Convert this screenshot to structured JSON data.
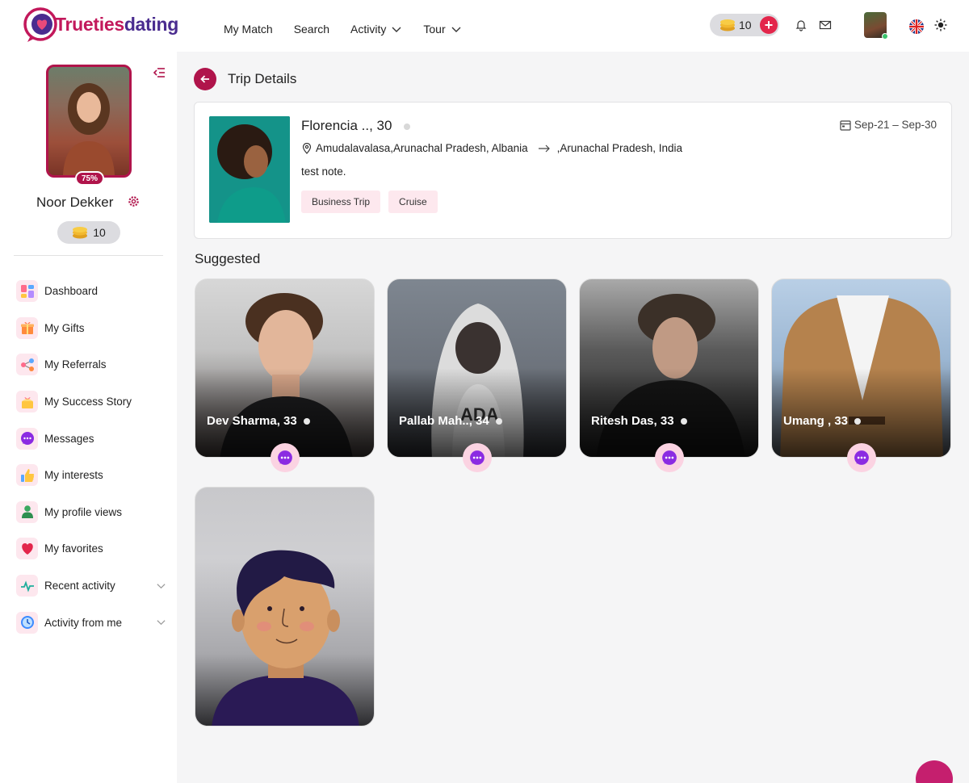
{
  "brand": {
    "part1": "Trueties",
    "part2": "dating"
  },
  "nav": [
    {
      "label": "My Match",
      "has_dropdown": false
    },
    {
      "label": "Search",
      "has_dropdown": false
    },
    {
      "label": "Activity",
      "has_dropdown": true
    },
    {
      "label": "Tour",
      "has_dropdown": true
    }
  ],
  "header": {
    "coins": "10"
  },
  "profile": {
    "name": "Noor Dekker",
    "completion": "75%",
    "coins": "10"
  },
  "menu": [
    {
      "label": "Dashboard",
      "icon": "dashboard-icon"
    },
    {
      "label": "My Gifts",
      "icon": "gift-icon"
    },
    {
      "label": "My Referrals",
      "icon": "share-icon"
    },
    {
      "label": "My Success Story",
      "icon": "box-icon"
    },
    {
      "label": "Messages",
      "icon": "chat-icon"
    },
    {
      "label": "My interests",
      "icon": "thumbs-up-icon"
    },
    {
      "label": "My profile views",
      "icon": "person-icon"
    },
    {
      "label": "My favorites",
      "icon": "heart-icon"
    },
    {
      "label": "Recent activity",
      "icon": "pulse-icon",
      "expandable": true
    },
    {
      "label": "Activity from me",
      "icon": "clock-icon",
      "expandable": true
    }
  ],
  "page": {
    "title": "Trip Details"
  },
  "trip": {
    "name": "Florencia .., 30",
    "dates": "Sep-21 – Sep-30",
    "from": "Amudalavalasa,Arunachal Pradesh, Albania",
    "to": ",Arunachal Pradesh, India",
    "note": "test note.",
    "tags": [
      "Business Trip",
      "Cruise"
    ]
  },
  "suggested": {
    "title": "Suggested",
    "people": [
      {
        "name": "Dev Sharma, 33"
      },
      {
        "name": "Pallab Mah.., 34"
      },
      {
        "name": "Ritesh Das, 33"
      },
      {
        "name": "Umang , 33"
      }
    ]
  },
  "colors": {
    "brand": "#b0144b",
    "accent_pink": "#fde8ee",
    "chat_purple": "#8b2be2"
  }
}
